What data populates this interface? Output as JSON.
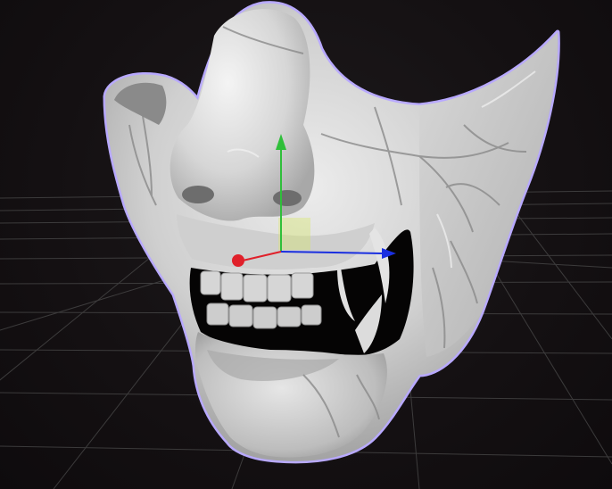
{
  "viewport": {
    "background_color": "#141012",
    "grid_color": "#5a5a5a"
  },
  "model": {
    "name": "",
    "selected": true,
    "selection_outline_color": "#b8a9ff",
    "surface_color": "#d9d9d9"
  },
  "gizmo": {
    "x_axis_color": "#e0202a",
    "y_axis_color": "#2fbf3a",
    "z_axis_color": "#1a2fe0",
    "center_plane_color": "#d4e85a"
  },
  "icons": {
    "translate_gizmo": "move-gizmo-icon"
  }
}
